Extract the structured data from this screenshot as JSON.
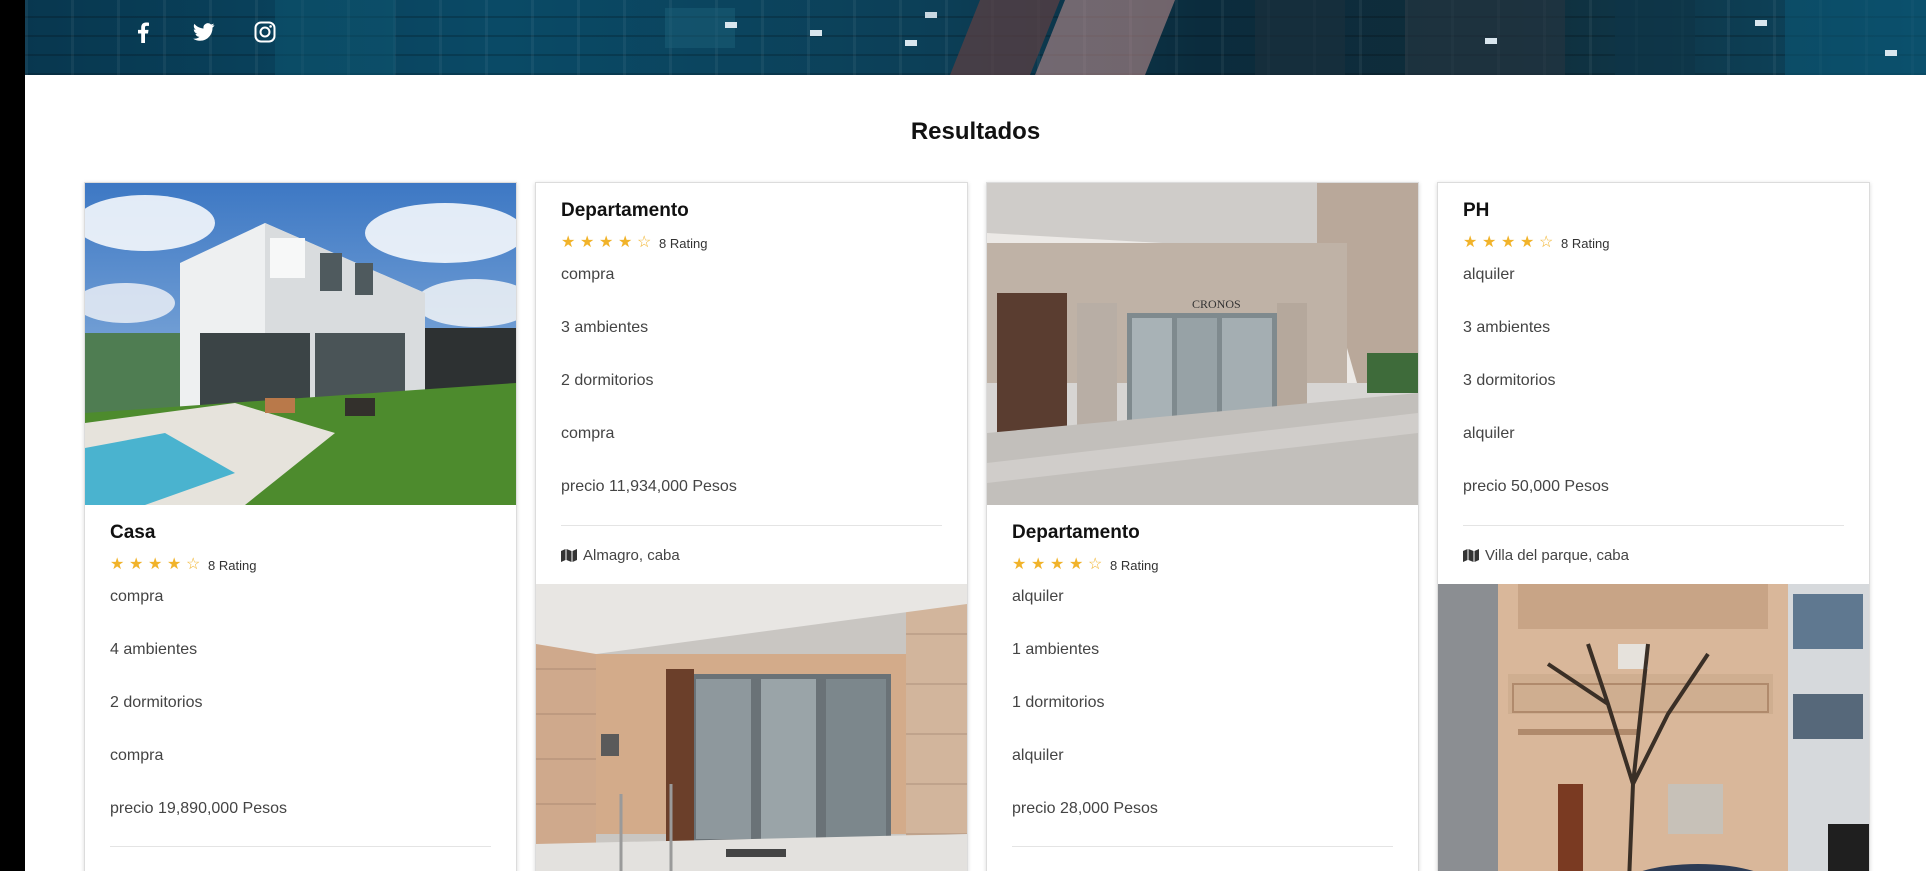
{
  "social": [
    {
      "icon": "facebook-icon"
    },
    {
      "icon": "twitter-icon"
    },
    {
      "icon": "instagram-icon"
    }
  ],
  "section_title": "Resultados",
  "colors": {
    "star": "#f1b32a",
    "header_bg": "#0a4a66"
  },
  "cards": [
    {
      "title": "Casa",
      "stars": 4,
      "rating_text": "8 Rating",
      "rows": [
        "compra",
        "4 ambientes",
        "2 dormitorios",
        "compra",
        "precio 19,890,000 Pesos"
      ],
      "photo": "house-photo"
    },
    {
      "title": "Departamento",
      "stars": 4,
      "rating_text": "8 Rating",
      "rows": [
        "compra",
        "3 ambientes",
        "2 dormitorios",
        "compra",
        "precio 11,934,000 Pesos"
      ],
      "location": "Almagro, caba",
      "photo": "lobby-photo"
    },
    {
      "title": "Departamento",
      "stars": 4,
      "rating_text": "8 Rating",
      "rows": [
        "alquiler",
        "1 ambientes",
        "1 dormitorios",
        "alquiler",
        "precio 28,000 Pesos"
      ],
      "photo": "building-photo"
    },
    {
      "title": "PH",
      "stars": 4,
      "rating_text": "8 Rating",
      "rows": [
        "alquiler",
        "3 ambientes",
        "3 dormitorios",
        "alquiler",
        "precio 50,000 Pesos"
      ],
      "location": "Villa del parque, caba",
      "photo": "facade-photo"
    }
  ]
}
